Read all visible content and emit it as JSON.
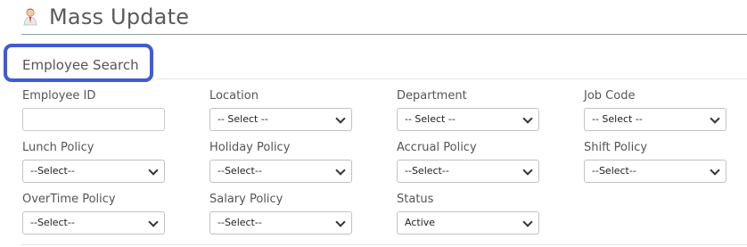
{
  "header": {
    "title": "Mass Update",
    "icon": "person-icon"
  },
  "section": {
    "title": "Employee Search",
    "highlight_color": "#3f5bd8"
  },
  "fields": {
    "employee_id": {
      "label": "Employee ID",
      "value": ""
    },
    "location": {
      "label": "Location",
      "selected": "-- Select --"
    },
    "department": {
      "label": "Department",
      "selected": "-- Select --"
    },
    "job_code": {
      "label": "Job Code",
      "selected": "-- Select --"
    },
    "lunch_policy": {
      "label": "Lunch Policy",
      "selected": "--Select--"
    },
    "holiday_policy": {
      "label": "Holiday Policy",
      "selected": "--Select--"
    },
    "accrual_policy": {
      "label": "Accrual Policy",
      "selected": "--Select--"
    },
    "shift_policy": {
      "label": "Shift Policy",
      "selected": "--Select--"
    },
    "overtime_policy": {
      "label": "OverTime Policy",
      "selected": "--Select--"
    },
    "salary_policy": {
      "label": "Salary Policy",
      "selected": "--Select--"
    },
    "status": {
      "label": "Status",
      "selected": "Active"
    }
  }
}
